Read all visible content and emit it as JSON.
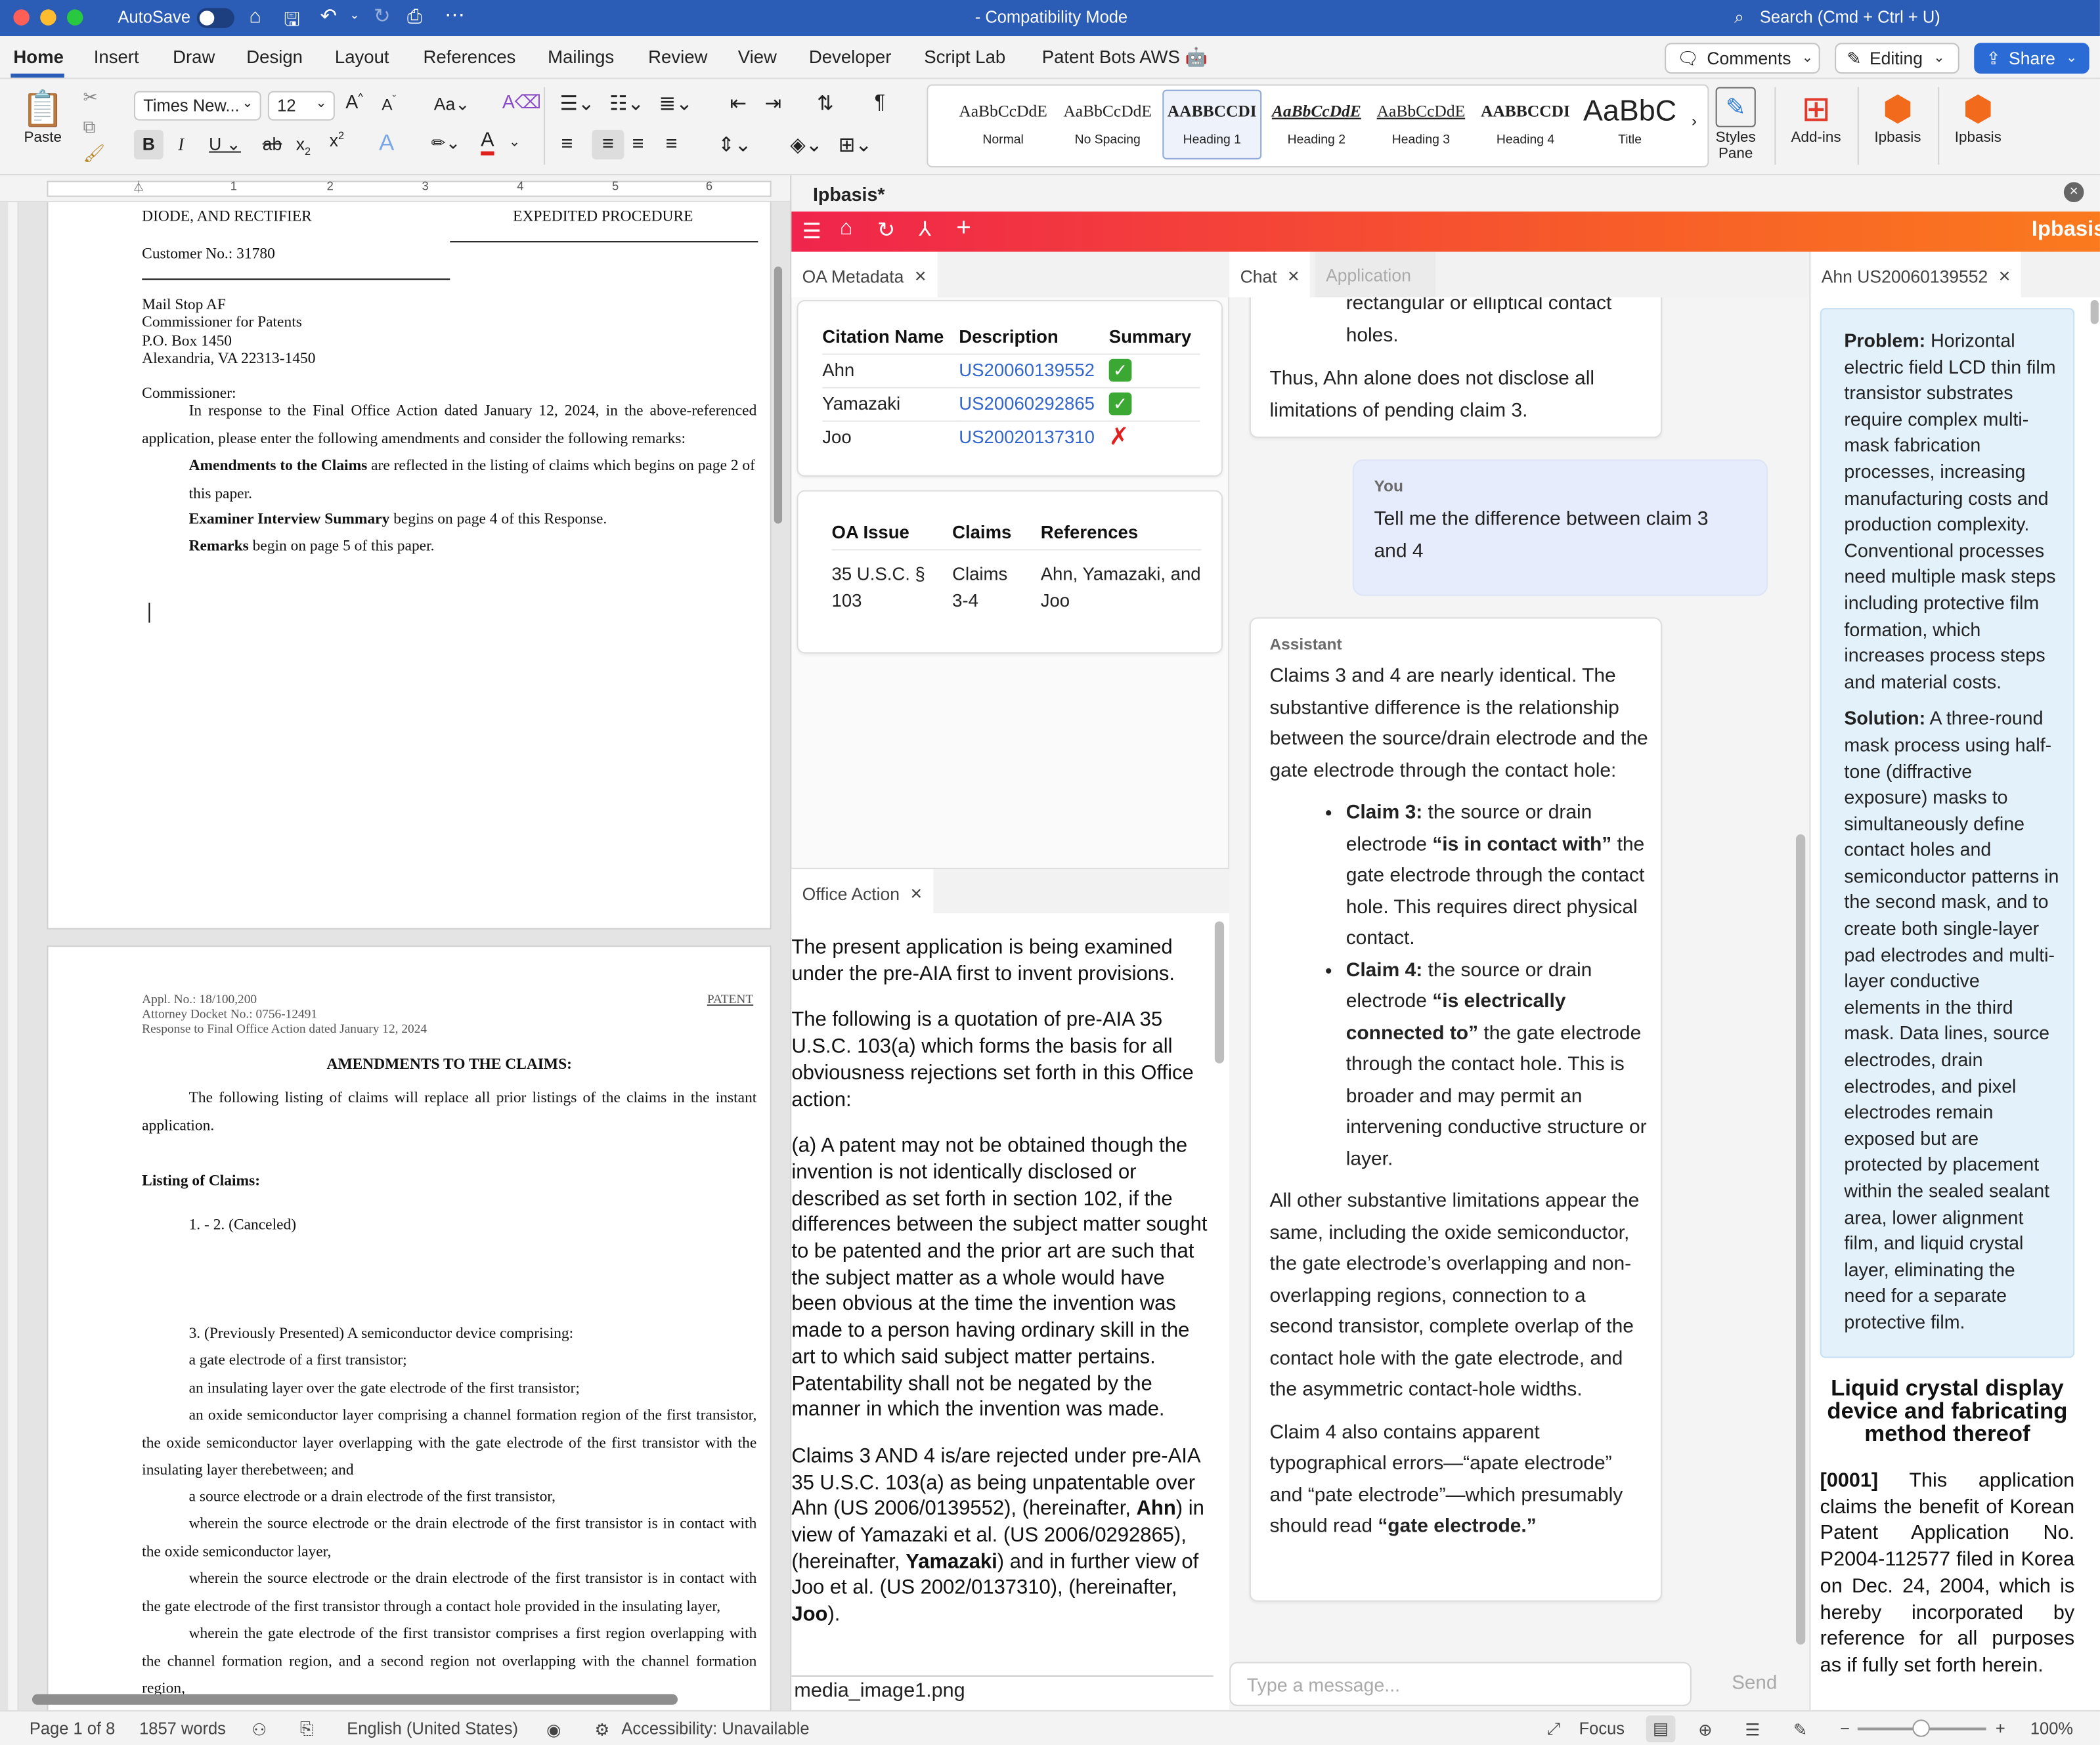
{
  "titlebar": {
    "autosave": "AutoSave",
    "title": "-  Compatibility Mode",
    "search": "Search (Cmd + Ctrl + U)"
  },
  "ribbon_tabs": [
    "Home",
    "Insert",
    "Draw",
    "Design",
    "Layout",
    "References",
    "Mailings",
    "Review",
    "View",
    "Developer",
    "Script Lab",
    "Patent Bots AWS 🤖"
  ],
  "ribbon_right": {
    "comments": "Comments",
    "editing": "Editing",
    "share": "Share"
  },
  "ribbon": {
    "paste": "Paste",
    "font": "Times New...",
    "size": "12",
    "styles_pane": "Styles Pane",
    "addins": "Add-ins",
    "ipbasis1": "Ipbasis",
    "ipbasis2": "Ipbasis"
  },
  "styles": [
    {
      "sample": "AaBbCcDdE",
      "name": "Normal"
    },
    {
      "sample": "AaBbCcDdE",
      "name": "No Spacing"
    },
    {
      "sample": "AABBCCDI",
      "name": "Heading 1"
    },
    {
      "sample": "AaBbCcDdE",
      "name": "Heading 2"
    },
    {
      "sample": "AaBbCcDdE",
      "name": "Heading 3"
    },
    {
      "sample": "AABBCCDI",
      "name": "Heading 4"
    },
    {
      "sample": "AaBbC",
      "name": "Title"
    }
  ],
  "ruler": [
    "1",
    "2",
    "3",
    "4",
    "5",
    "6"
  ],
  "page1": {
    "l1": "DIODE, AND RECTIFIER",
    "r1": "EXPEDITED PROCEDURE",
    "customer": "Customer No.: 31780",
    "addr": [
      "Mail Stop AF",
      "Commissioner for Patents",
      "P.O. Box 1450",
      "Alexandria, VA 22313-1450"
    ],
    "salute": "Commissioner:",
    "para1": "In response to the Final Office Action dated January 12, 2024, in the above-referenced application, please enter the following amendments and consider the following remarks:",
    "amend_b": "Amendments to the Claims",
    "amend": " are reflected in the listing of claims which begins on page 2 of this paper.",
    "exam_b": "Examiner Interview Summary",
    "exam": " begins on page 4 of this Response.",
    "rem_b": "Remarks",
    "rem": " begin on page 5 of this paper."
  },
  "page2": {
    "appl": "Appl. No.: 18/100,200",
    "docket": "Attorney Docket No.: 0756-12491",
    "resp": "Response to Final Office Action dated January 12, 2024",
    "patent": "PATENT",
    "heading": "AMENDMENTS TO THE CLAIMS:",
    "intro": "The following listing of claims will replace all prior listings of the claims in the instant application.",
    "listing": "Listing of Claims:",
    "c12": "1. - 2. (Canceled)",
    "c3": "3. (Previously Presented) A semiconductor device comprising:",
    "c3a": "a gate electrode of a first transistor;",
    "c3b": "an insulating layer over the gate electrode of the first transistor;",
    "c3c": "an oxide semiconductor layer comprising a channel formation region of the first transistor, the oxide semiconductor layer overlapping with the gate electrode of the first transistor with the insulating layer therebetween; and",
    "c3d": "a source electrode or a drain electrode of the first transistor,",
    "c3e": "wherein the source electrode or the drain electrode of the first transistor is in contact with the oxide semiconductor layer,",
    "c3f": "wherein the source electrode or the drain electrode of the first transistor is in contact with the gate electrode of the first transistor through a contact hole provided in the insulating layer,",
    "c3g": "wherein the gate electrode of the first transistor comprises a first region overlapping with the channel formation region, and a second region not overlapping with the channel formation region,"
  },
  "addin": {
    "title": "Ipbasis*",
    "brand": "Ipbasis"
  },
  "panel_tabs": {
    "oa_metadata": "OA Metadata",
    "chat": "Chat",
    "application": "Application",
    "ahn": "Ahn US20060139552",
    "office_action": "Office Action"
  },
  "citations": {
    "headers": [
      "Citation Name",
      "Description",
      "Summary"
    ],
    "rows": [
      {
        "name": "Ahn",
        "desc": "US20060139552",
        "summary": "check"
      },
      {
        "name": "Yamazaki",
        "desc": "US20060292865",
        "summary": "check"
      },
      {
        "name": "Joo",
        "desc": "US20020137310",
        "summary": "cross"
      }
    ]
  },
  "issues": {
    "headers": [
      "OA Issue",
      "Claims",
      "References"
    ],
    "row": [
      "35 U.S.C. § 103",
      "Claims 3-4",
      "Ahn, Yamazaki, and Joo"
    ]
  },
  "office_action": {
    "p1": "The present application is being examined under the pre-AIA first to invent provisions.",
    "p2": "The following is a quotation of pre-AIA 35 U.S.C. 103(a) which forms the basis for all obviousness rejections set forth in this Office action:",
    "p3": "(a) A patent may not be obtained though the invention is not identically disclosed or described as set forth in section 102, if the differences between the subject matter sought to be patented and the prior art are such that the subject matter as a whole would have been obvious at the time the invention was made to a person having ordinary skill in the art to which said subject matter pertains. Patentability shall not be negated by the manner in which the invention was made.",
    "p4a": "Claims 3 AND 4 is/are rejected under pre-AIA 35 U.S.C. 103(a) as being unpatentable over Ahn (US 2006/0139552), (hereinafter, ",
    "p4b": "Ahn",
    "p4c": ") in view of Yamazaki et al. (US 2006/0292865), (hereinafter, ",
    "p4d": "Yamazaki",
    "p4e": ") and in further view of Joo et al. (US 2002/0137310), (hereinafter, ",
    "p4f": "Joo",
    "p4g": ").",
    "media": "media_image1.png"
  },
  "chat": {
    "prev1": "rectangular or elliptical contact",
    "prev2": "holes.",
    "prev3": "Thus, Ahn alone does not disclose all limitations of pending claim 3.",
    "you": "You",
    "user_msg": "Tell me the difference between claim 3 and 4",
    "assistant": "Assistant",
    "a1": "Claims 3 and 4 are nearly identical. The substantive difference is the relationship between the source/drain electrode and the gate electrode through the contact hole:",
    "b1_label": "Claim 3:",
    "b1_a": " the source or drain electrode ",
    "b1_b": "“is in contact with”",
    "b1_c": " the gate electrode through the contact hole. This requires direct physical contact.",
    "b2_label": "Claim 4:",
    "b2_a": " the source or drain electrode ",
    "b2_b": "“is electrically connected to”",
    "b2_c": " the gate electrode through the contact hole. This is broader and may permit an intervening conductive structure or layer.",
    "a2": "All other substantive limitations appear the same, including the oxide semiconductor, the gate electrode’s overlapping and non-overlapping regions, connection to a second transistor, complete overlap of the contact hole with the gate electrode, and the asymmetric contact-hole widths.",
    "a3a": "Claim 4 also contains apparent typographical errors—“apate electrode” and “pate electrode”—which presumably should read ",
    "a3b": "“gate electrode.”",
    "placeholder": "Type a message...",
    "send": "Send"
  },
  "ahn": {
    "problem_label": "Problem:",
    "problem": " Horizontal electric field LCD thin film transistor substrates require complex multi-mask fabrication processes, increasing manufacturing costs and production complexity. Conventional processes need multiple mask steps including protective film formation, which increases process steps and material costs.",
    "solution_label": "Solution:",
    "solution": " A three-round mask process using half-tone (diffractive exposure) masks to simultaneously define contact holes and semiconductor patterns in the second mask, and to create both single-layer pad electrodes and multi-layer conductive elements in the third mask. Data lines, source electrodes, drain electrodes, and pixel electrodes remain exposed but are protected by placement within the sealed sealant area, lower alignment film, and liquid crystal layer, eliminating the need for a separate protective film.",
    "doc_title": "Liquid crystal display device and fabricating method thereof",
    "para_num": "[0001]",
    "para": " This application claims the benefit of Korean Patent Application No. P2004-112577 filed in Korea on Dec. 24, 2004, which is hereby incorporated by reference for all purposes as if fully set forth herein."
  },
  "status": {
    "page": "Page 1 of 8",
    "words": "1857 words",
    "lang": "English (United States)",
    "access": "Accessibility: Unavailable",
    "focus": "Focus",
    "zoom": "100%"
  },
  "colors": {
    "titlebar": "#2b5cb6",
    "accent_orange": "#fb7a1e",
    "accent_red": "#f0244c",
    "link": "#3366cc",
    "ahn_bg": "#e3f1fb"
  }
}
